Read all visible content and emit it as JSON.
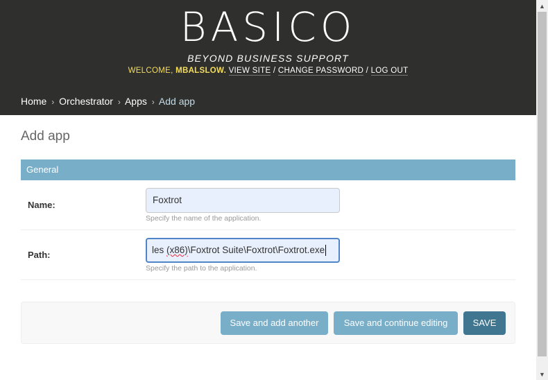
{
  "header": {
    "logo": "BASICO",
    "tagline": "BEYOND BUSINESS SUPPORT",
    "welcome": "WELCOME,",
    "username": "MBALSLOW",
    "links": {
      "view_site": "VIEW SITE",
      "change_password": "CHANGE PASSWORD",
      "log_out": "LOG OUT"
    },
    "separator": "/"
  },
  "breadcrumbs": {
    "items": [
      "Home",
      "Orchestrator",
      "Apps"
    ],
    "current": "Add app",
    "arrow": "›"
  },
  "page_title": "Add app",
  "fieldset": {
    "title": "General",
    "fields": [
      {
        "label": "Name:",
        "value": "Foxtrot",
        "help": "Specify the name of the application."
      },
      {
        "label": "Path:",
        "value_prefix": "les ",
        "value_underlined": "(x86)",
        "value_suffix": "\\Foxtrot Suite\\Foxtrot\\Foxtrot.exe",
        "help": "Specify the path to the application."
      }
    ]
  },
  "buttons": {
    "save_add_another": "Save and add another",
    "save_continue": "Save and continue editing",
    "save": "SAVE"
  },
  "colors": {
    "header_bg": "#2f2f2d",
    "accent": "#79aec8",
    "primary": "#417690",
    "welcome": "#f5dd5d"
  },
  "icons": {
    "scroll_up": "triangle-up-icon",
    "scroll_down": "triangle-down-icon"
  }
}
